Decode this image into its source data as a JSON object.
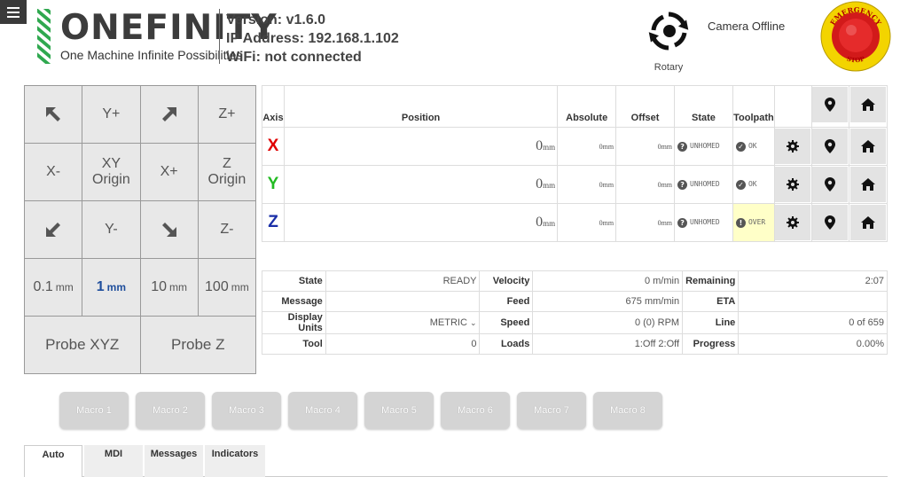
{
  "header": {
    "logo_word": "ONEFINITY",
    "logo_tagline": "One Machine Infinite Possibilities",
    "version": "Version: v1.6.0",
    "ip": "IP Address: 192.168.1.102",
    "wifi": "WiFi: not connected",
    "rotary_label": "Rotary",
    "camera_status": "Camera Offline",
    "estop_top": "EMERGENCY",
    "estop_bottom": "STOP"
  },
  "jog": {
    "buttons": [
      {
        "icon": "arrow-up-left-icon"
      },
      {
        "label": "Y+"
      },
      {
        "icon": "arrow-up-right-icon"
      },
      {
        "label": "Z+"
      },
      {
        "label": "X-"
      },
      {
        "label": "XY\nOrigin"
      },
      {
        "label": "X+"
      },
      {
        "label": "Z\nOrigin"
      },
      {
        "icon": "arrow-down-left-icon"
      },
      {
        "label": "Y-"
      },
      {
        "icon": "arrow-down-right-icon"
      },
      {
        "label": "Z-"
      }
    ],
    "steps": [
      {
        "value": "0.1",
        "unit": "mm"
      },
      {
        "value": "1",
        "unit": "mm",
        "active": true
      },
      {
        "value": "10",
        "unit": "mm"
      },
      {
        "value": "100",
        "unit": "mm"
      }
    ],
    "probe_xyz": "Probe XYZ",
    "probe_z": "Probe Z"
  },
  "axes": {
    "headers": {
      "axis": "Axis",
      "position": "Position",
      "absolute": "Absolute",
      "offset": "Offset",
      "state": "State",
      "toolpath": "Toolpath"
    },
    "rows": [
      {
        "axis": "X",
        "color": "#e00000",
        "position": "0",
        "unit": "mm",
        "absolute": "0",
        "offset": "0",
        "state": "UNHOMED",
        "toolpath": "OK",
        "toolpath_warn": false
      },
      {
        "axis": "Y",
        "color": "#22bb22",
        "position": "0",
        "unit": "mm",
        "absolute": "0",
        "offset": "0",
        "state": "UNHOMED",
        "toolpath": "OK",
        "toolpath_warn": false
      },
      {
        "axis": "Z",
        "color": "#1a2fa8",
        "position": "0",
        "unit": "mm",
        "absolute": "0",
        "offset": "0",
        "state": "UNHOMED",
        "toolpath": "OVER",
        "toolpath_warn": true
      }
    ],
    "unit_suffix": "mm",
    "state_badge": "?",
    "ok_badge": "✓",
    "warn_badge": "!"
  },
  "status": {
    "state_label": "State",
    "state_value": "READY",
    "message_label": "Message",
    "message_value": "",
    "units_label": "Display Units",
    "units_value": "METRIC",
    "tool_label": "Tool",
    "tool_value": "0",
    "velocity_label": "Velocity",
    "velocity_value": "0 m/min",
    "feed_label": "Feed",
    "feed_value": "675 mm/min",
    "speed_label": "Speed",
    "speed_value": "0 (0) RPM",
    "loads_label": "Loads",
    "loads_value": "1:Off 2:Off",
    "remaining_label": "Remaining",
    "remaining_value": "2:07",
    "eta_label": "ETA",
    "eta_value": "",
    "line_label": "Line",
    "line_value": "0 of 659",
    "progress_label": "Progress",
    "progress_value": "0.00%"
  },
  "macros": [
    "Macro 1",
    "Macro 2",
    "Macro 3",
    "Macro 4",
    "Macro 5",
    "Macro 6",
    "Macro 7",
    "Macro 8"
  ],
  "tabs": [
    {
      "label": "Auto",
      "active": true
    },
    {
      "label": "MDI"
    },
    {
      "label": "Messages"
    },
    {
      "label": "Indicators"
    }
  ]
}
